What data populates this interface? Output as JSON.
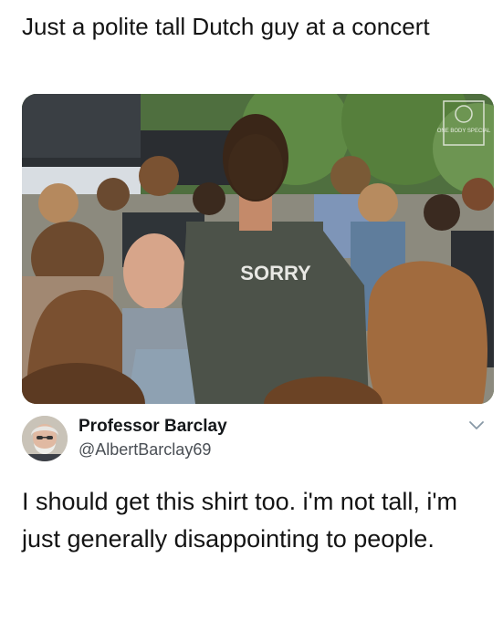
{
  "post": {
    "caption": "Just a polite tall Dutch guy at a concert"
  },
  "photo": {
    "shirt_text": "SORRY",
    "watermark_text": "ONE BODY SPECIAL"
  },
  "tweet": {
    "author_name": "Professor Barclay",
    "author_handle": "@AlbertBarclay69",
    "text": "I should get this shirt too. i'm not tall, i'm just generally disappointing to people."
  },
  "icons": {
    "menu": "chevron-down-icon"
  },
  "colors": {
    "text": "#141414",
    "handle": "#4a4f55",
    "chevron": "#8899a6"
  }
}
